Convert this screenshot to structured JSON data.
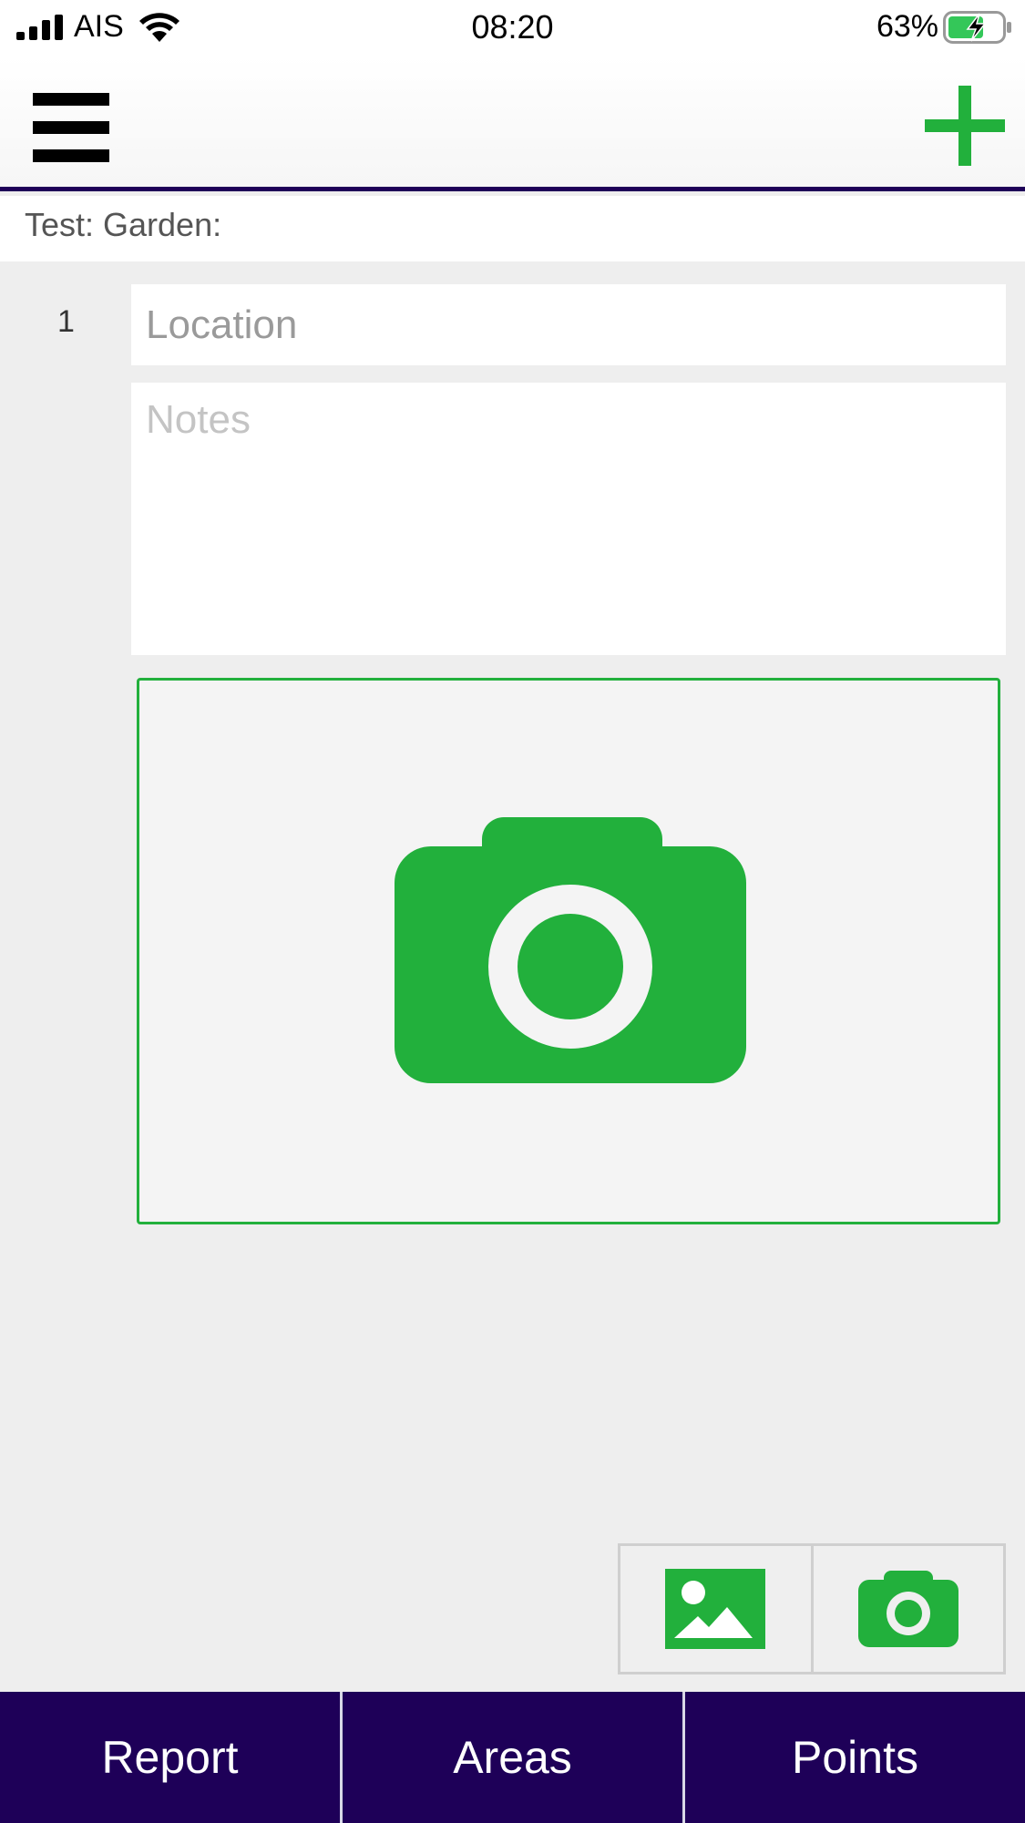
{
  "status_bar": {
    "carrier": "AIS",
    "time": "08:20",
    "battery_percent": "63%"
  },
  "nav": {
    "menu_icon": "hamburger-menu-icon",
    "add_icon": "plus-icon"
  },
  "breadcrumb": "Test: Garden:",
  "point": {
    "number": "1",
    "location_placeholder": "Location",
    "location_value": "",
    "notes_placeholder": "Notes",
    "notes_value": ""
  },
  "photo_box": {
    "icon": "camera-icon"
  },
  "image_buttons": [
    {
      "icon": "gallery-icon"
    },
    {
      "icon": "camera-icon"
    }
  ],
  "tabs": [
    {
      "label": "Report"
    },
    {
      "label": "Areas"
    },
    {
      "label": "Points"
    }
  ],
  "colors": {
    "accent": "#22b03c",
    "navy": "#1e0058",
    "background": "#eeeeee"
  }
}
